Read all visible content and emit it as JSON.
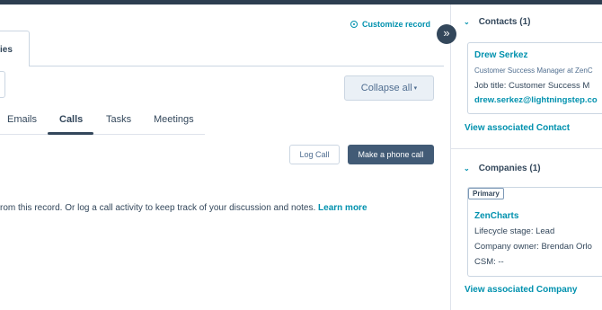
{
  "header": {
    "customize_label": "Customize record",
    "collapse_toggle_icon": "»"
  },
  "record_tabs": {
    "active_tab_fragment": "ies"
  },
  "toolbar": {
    "collapse_all_label": "Collapse all",
    "collapse_all_caret": "▾"
  },
  "activity_tabs": [
    {
      "label": "Emails",
      "active": false
    },
    {
      "label": "Calls",
      "active": true
    },
    {
      "label": "Tasks",
      "active": false
    },
    {
      "label": "Meetings",
      "active": false
    }
  ],
  "call_actions": {
    "log_call_label": "Log Call",
    "make_call_label": "Make a phone call"
  },
  "empty_state": {
    "message": "rom this record. Or log a call activity to keep track of your discussion and notes.",
    "learn_more_label": "Learn more"
  },
  "sidebar": {
    "contacts": {
      "title": "Contacts (1)",
      "contact": {
        "name": "Drew Serkez",
        "headline": "Customer Success Manager at ZenC",
        "job_title_line": "Job title:  Customer Success M",
        "email": "drew.serkez@lightningstep.co"
      },
      "view_link": "View associated Contact"
    },
    "companies": {
      "title": "Companies (1)",
      "company": {
        "badge": "Primary",
        "name": "ZenCharts",
        "lifecycle_line": "Lifecycle stage:  Lead",
        "owner_line": "Company owner:  Brendan Orlo",
        "csm_line": "CSM:  --"
      },
      "view_link": "View associated Company"
    }
  }
}
